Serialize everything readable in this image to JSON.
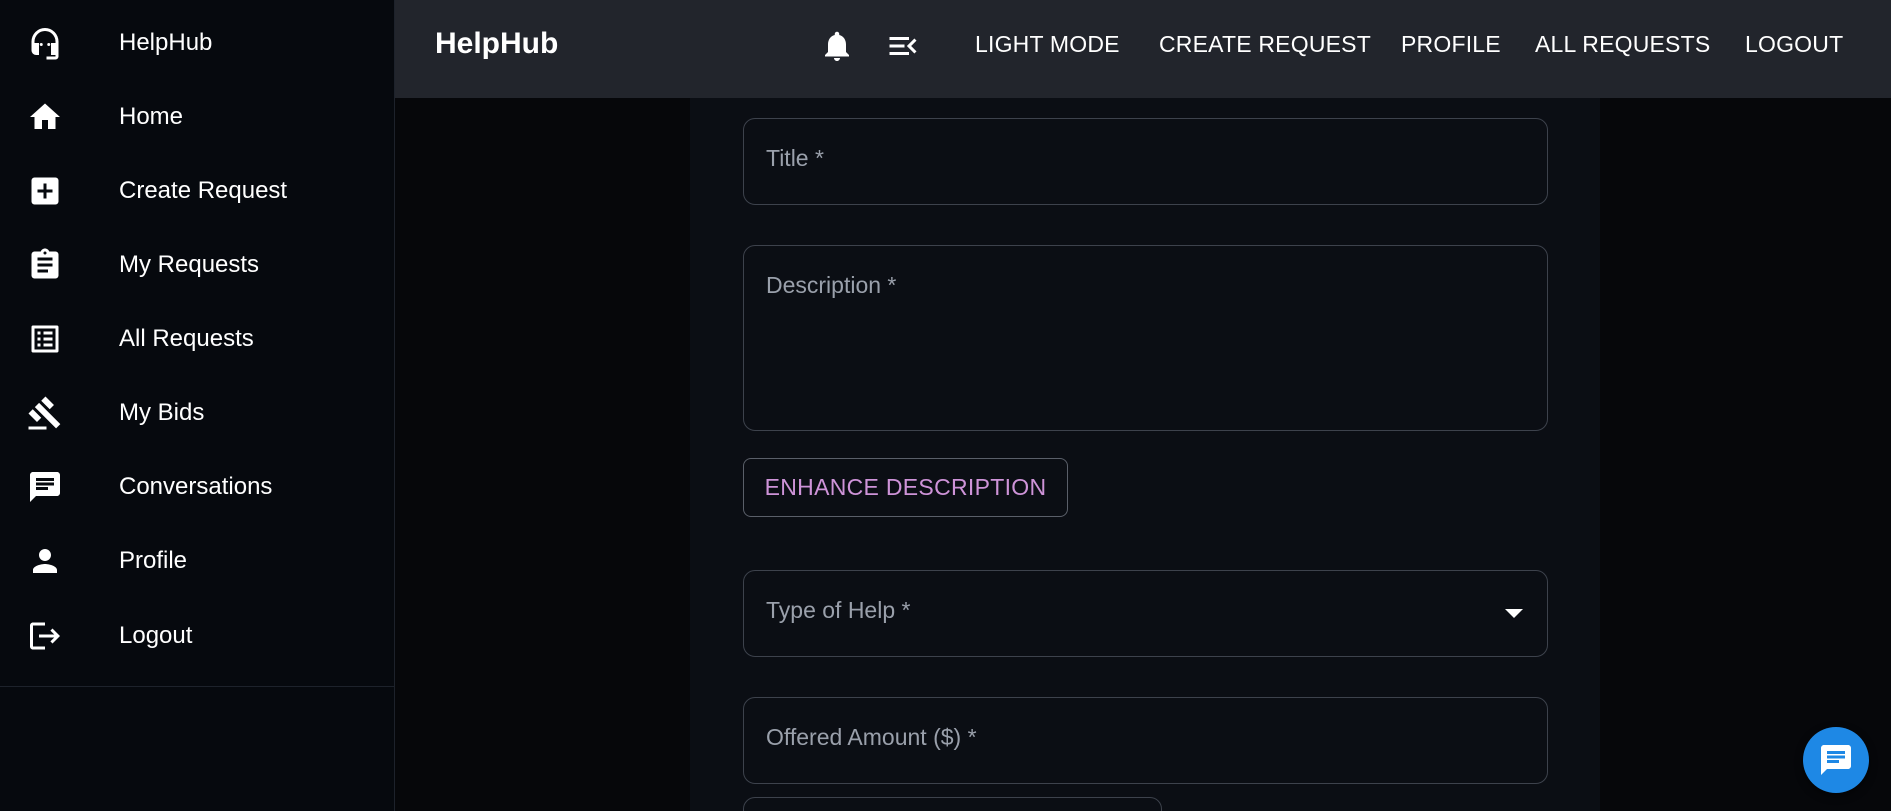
{
  "sidebar": {
    "items": [
      {
        "label": "HelpHub",
        "icon": "headset-icon"
      },
      {
        "label": "Home",
        "icon": "home-icon"
      },
      {
        "label": "Create Request",
        "icon": "add-box-icon"
      },
      {
        "label": "My Requests",
        "icon": "clipboard-icon"
      },
      {
        "label": "All Requests",
        "icon": "list-icon"
      },
      {
        "label": "My Bids",
        "icon": "gavel-icon"
      },
      {
        "label": "Conversations",
        "icon": "chat-icon"
      },
      {
        "label": "Profile",
        "icon": "person-icon"
      },
      {
        "label": "Logout",
        "icon": "logout-icon"
      }
    ]
  },
  "header": {
    "brand": "HelpHub",
    "icons": [
      "bell-icon",
      "menu-collapse-icon"
    ],
    "nav": [
      "LIGHT MODE",
      "CREATE REQUEST",
      "PROFILE",
      "ALL REQUESTS",
      "LOGOUT"
    ]
  },
  "form": {
    "title_label": "Title *",
    "description_label": "Description *",
    "enhance_button": "ENHANCE DESCRIPTION",
    "type_label": "Type of Help *",
    "amount_label": "Offered Amount ($) *"
  },
  "colors": {
    "sidebar_bg": "#06090e",
    "topbar_bg": "#22252c",
    "card_bg": "#0b0e14",
    "accent_button_text": "#ce93d8",
    "fab": "#1e88e5"
  }
}
